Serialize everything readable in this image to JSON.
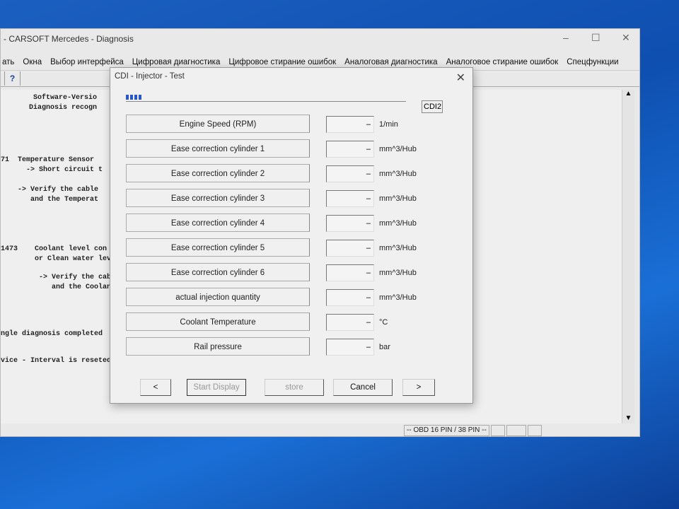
{
  "app": {
    "title": "- CARSOFT Mercedes - Diagnosis",
    "menu": [
      "ать",
      "Окна",
      "Выбор интерфейса",
      "Цифровая диагностика",
      "Цифровое стирание ошибок",
      "Аналоговая диагностика",
      "Аналоговое стирание ошибок",
      "Спецфункции"
    ],
    "toolbar_help": "?",
    "log": [
      "Software-Versio",
      "Diagnosis recogn",
      "71  Temperature Sensor",
      "      -> Short circuit t",
      "    -> Verify the cable",
      "       and the Temperat",
      "1473    Coolant level con",
      "        or Clean water lev",
      "         -> Verify the cabl",
      "            and the Coolant",
      "ngle diagnosis completed",
      "vice - Interval is reseted"
    ],
    "status": "-- OBD 16 PIN /  38 PIN  --"
  },
  "dialog": {
    "title": "CDI - Injector - Test",
    "ecu": "CDI2",
    "progress_percent": 6,
    "rows": [
      {
        "label": "Engine Speed (RPM)",
        "value": "–",
        "unit": "1/min"
      },
      {
        "label": "Ease correction cylinder 1",
        "value": "–",
        "unit": "mm^3/Hub"
      },
      {
        "label": "Ease correction cylinder 2",
        "value": "–",
        "unit": "mm^3/Hub"
      },
      {
        "label": "Ease correction cylinder 3",
        "value": "–",
        "unit": "mm^3/Hub"
      },
      {
        "label": "Ease correction cylinder 4",
        "value": "–",
        "unit": "mm^3/Hub"
      },
      {
        "label": "Ease correction cylinder 5",
        "value": "–",
        "unit": "mm^3/Hub"
      },
      {
        "label": "Ease correction cylinder 6",
        "value": "–",
        "unit": "mm^3/Hub"
      },
      {
        "label": "actual injection quantity",
        "value": "–",
        "unit": "mm^3/Hub"
      },
      {
        "label": "Coolant Temperature",
        "value": "–",
        "unit": "°C"
      },
      {
        "label": "Rail pressure",
        "value": "–",
        "unit": "bar"
      }
    ],
    "buttons": {
      "prev": "<",
      "start": "Start Display",
      "store": "store",
      "cancel": "Cancel",
      "next": ">"
    }
  }
}
